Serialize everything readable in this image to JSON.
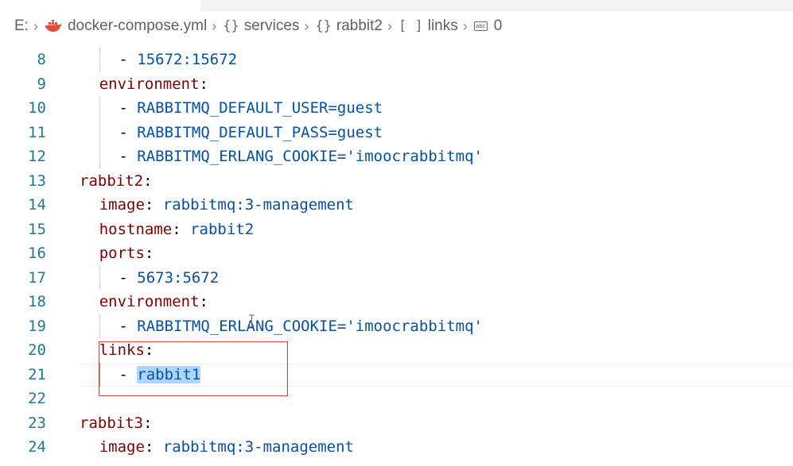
{
  "breadcrumb": {
    "drive": "E:",
    "file": "docker-compose.yml",
    "items": [
      {
        "symbol": "{}",
        "label": "services"
      },
      {
        "symbol": "{}",
        "label": "rabbit2"
      },
      {
        "symbol": "[ ]",
        "label": "links"
      }
    ],
    "leaf": "0",
    "file_icon": "docker-whale-icon",
    "leaf_icon": "string-abc-icon"
  },
  "colors": {
    "line_number": "#237893",
    "key": "#800000",
    "value": "#0451a5",
    "selection": "#add6ff",
    "highlight_box": "#d9413a"
  },
  "editor": {
    "lines": [
      {
        "n": "8",
        "indent": 2,
        "tokens": [
          {
            "t": "- ",
            "c": "p"
          },
          {
            "t": "15672:15672",
            "c": "s"
          }
        ]
      },
      {
        "n": "9",
        "indent": 1,
        "tokens": [
          {
            "t": "environment",
            "c": "k"
          },
          {
            "t": ":",
            "c": "p"
          }
        ]
      },
      {
        "n": "10",
        "indent": 2,
        "tokens": [
          {
            "t": "- ",
            "c": "p"
          },
          {
            "t": "RABBITMQ_DEFAULT_USER=guest",
            "c": "s"
          }
        ]
      },
      {
        "n": "11",
        "indent": 2,
        "tokens": [
          {
            "t": "- ",
            "c": "p"
          },
          {
            "t": "RABBITMQ_DEFAULT_PASS=guest",
            "c": "s"
          }
        ]
      },
      {
        "n": "12",
        "indent": 2,
        "tokens": [
          {
            "t": "- ",
            "c": "p"
          },
          {
            "t": "RABBITMQ_ERLANG_COOKIE='imoocrabbitmq'",
            "c": "s"
          }
        ]
      },
      {
        "n": "13",
        "indent": 0,
        "tokens": [
          {
            "t": "rabbit2",
            "c": "k"
          },
          {
            "t": ":",
            "c": "p"
          }
        ]
      },
      {
        "n": "14",
        "indent": 1,
        "tokens": [
          {
            "t": "image",
            "c": "k"
          },
          {
            "t": ": ",
            "c": "p"
          },
          {
            "t": "rabbitmq:3-management",
            "c": "s"
          }
        ]
      },
      {
        "n": "15",
        "indent": 1,
        "tokens": [
          {
            "t": "hostname",
            "c": "k"
          },
          {
            "t": ": ",
            "c": "p"
          },
          {
            "t": "rabbit2",
            "c": "s"
          }
        ]
      },
      {
        "n": "16",
        "indent": 1,
        "tokens": [
          {
            "t": "ports",
            "c": "k"
          },
          {
            "t": ":",
            "c": "p"
          }
        ]
      },
      {
        "n": "17",
        "indent": 2,
        "tokens": [
          {
            "t": "- ",
            "c": "p"
          },
          {
            "t": "5673:5672",
            "c": "s"
          }
        ]
      },
      {
        "n": "18",
        "indent": 1,
        "tokens": [
          {
            "t": "environment",
            "c": "k"
          },
          {
            "t": ":",
            "c": "p"
          }
        ]
      },
      {
        "n": "19",
        "indent": 2,
        "tokens": [
          {
            "t": "- ",
            "c": "p"
          },
          {
            "t": "RABBITMQ_ERLANG_COOKIE='imoocrabbitmq'",
            "c": "s"
          }
        ]
      },
      {
        "n": "20",
        "indent": 1,
        "tokens": [
          {
            "t": "links",
            "c": "k"
          },
          {
            "t": ":",
            "c": "p"
          }
        ]
      },
      {
        "n": "21",
        "indent": 2,
        "current": true,
        "tokens": [
          {
            "t": "- ",
            "c": "p"
          },
          {
            "t": "rabbit1",
            "c": "s",
            "selected": true
          }
        ]
      },
      {
        "n": "22",
        "indent": 0,
        "tokens": []
      },
      {
        "n": "23",
        "indent": 0,
        "tokens": [
          {
            "t": "rabbit3",
            "c": "k"
          },
          {
            "t": ":",
            "c": "p"
          }
        ]
      },
      {
        "n": "24",
        "indent": 1,
        "tokens": [
          {
            "t": "image",
            "c": "k"
          },
          {
            "t": ": ",
            "c": "p"
          },
          {
            "t": "rabbitmq:3-management",
            "c": "s"
          }
        ]
      }
    ]
  }
}
